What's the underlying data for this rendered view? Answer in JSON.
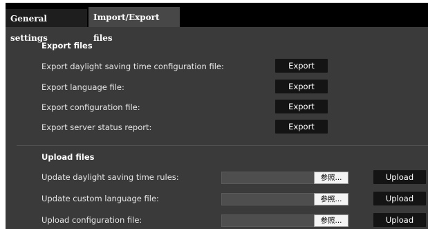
{
  "tabs": [
    {
      "label": "General settings"
    },
    {
      "label": "Import/Export files"
    }
  ],
  "export_section": {
    "title": "Export files",
    "rows": [
      {
        "label": "Export daylight saving time configuration file:",
        "button": "Export"
      },
      {
        "label": "Export language file:",
        "button": "Export"
      },
      {
        "label": "Export configuration file:",
        "button": "Export"
      },
      {
        "label": "Export server status report:",
        "button": "Export"
      }
    ]
  },
  "upload_section": {
    "title": "Upload files",
    "rows": [
      {
        "label": "Update daylight saving time rules:",
        "browse": "参照...",
        "button": "Upload"
      },
      {
        "label": "Update custom language file:",
        "browse": "参照...",
        "button": "Upload"
      },
      {
        "label": "Upload configuration file:",
        "browse": "参照...",
        "button": "Upload"
      }
    ]
  },
  "colors": {
    "background": "#3a3a3a",
    "tabbar": "#000000",
    "button": "#141414",
    "active_tab": "#474747"
  }
}
